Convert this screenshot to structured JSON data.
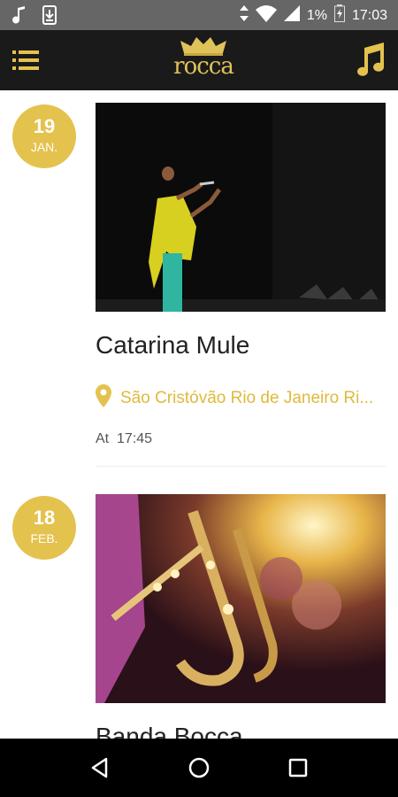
{
  "status_bar": {
    "battery": "1%",
    "time": "17:03",
    "icons": [
      "music-note-icon",
      "download-icon",
      "data-arrows-icon",
      "wifi-icon",
      "signal-icon",
      "battery-icon"
    ]
  },
  "app_bar": {
    "logo_text": "rocca",
    "menu_icon": "list-menu-icon",
    "music_icon": "music-note-icon",
    "accent_color": "#e4c24e"
  },
  "events": [
    {
      "day": "19",
      "month": "JAN.",
      "title": "Catarina Mule",
      "location": "São Cristóvão Rio de Janeiro Ri...",
      "time_label": "At",
      "time": "17:45",
      "image": "singer-on-stage"
    },
    {
      "day": "18",
      "month": "FEB.",
      "title": "Banda Bocca",
      "image": "saxophone-band"
    }
  ],
  "nav_bar": {
    "icons": [
      "back-icon",
      "home-icon",
      "recents-icon"
    ]
  }
}
